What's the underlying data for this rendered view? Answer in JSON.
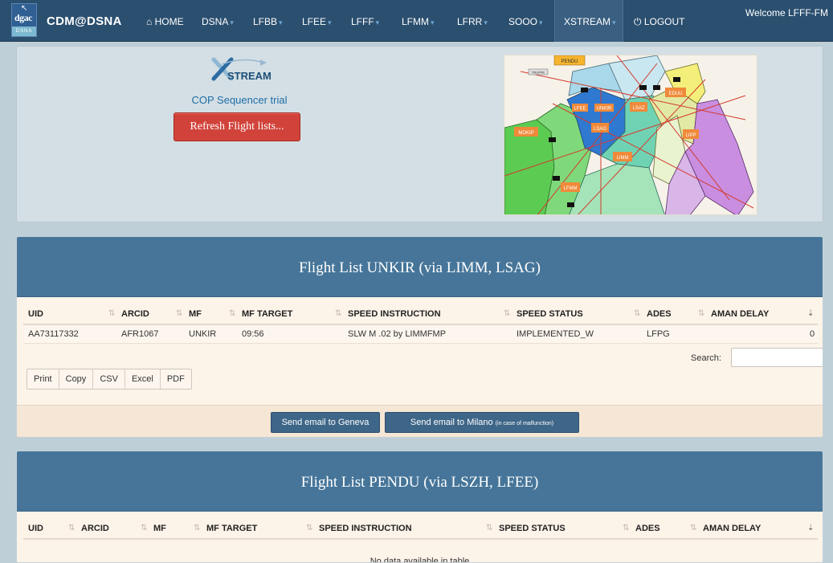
{
  "nav": {
    "logo_text": "dgac",
    "logo_sub": "DSNA",
    "logo_arrow": "↖",
    "brand": "CDM@DSNA",
    "home_icon": "home-icon",
    "items": [
      {
        "label": "HOME",
        "icon": "⌂"
      },
      {
        "label": "DSNA",
        "caret": "▾"
      },
      {
        "label": "LFBB",
        "caret": "▾"
      },
      {
        "label": "LFEE",
        "caret": "▾"
      },
      {
        "label": "LFFF",
        "caret": "▾"
      },
      {
        "label": "LFMM",
        "caret": "▾"
      },
      {
        "label": "LFRR",
        "caret": "▾"
      },
      {
        "label": "SOOO",
        "caret": "▾"
      },
      {
        "label": "XSTREAM",
        "caret": "▾"
      },
      {
        "label": "LOGOUT",
        "icon": "⏻"
      }
    ],
    "welcome": "Welcome LFFF-FM"
  },
  "xstream": {
    "logo_text": "STREAM",
    "logo_x": "X",
    "subtitle": "COP Sequencer trial",
    "refresh_label": "Refresh Flight lists...",
    "map_labels": [
      "PENDU",
      "TRUPPE",
      "LFEE",
      "EDUU",
      "UNKIR",
      "LSAZ",
      "LSAG",
      "MOKIP",
      "LIPP",
      "LIMM",
      "LFMM"
    ]
  },
  "list1": {
    "title": "Flight List UNKIR (via LIMM, LSAG)",
    "columns": [
      "UID",
      "ARCID",
      "MF",
      "MF TARGET",
      "SPEED INSTRUCTION",
      "SPEED STATUS",
      "ADES",
      "AMAN DELAY"
    ],
    "rows": [
      [
        "AA73117332",
        "AFR1067",
        "UNKIR",
        "09:56",
        "SLW M .02 by LIMMFMP",
        "IMPLEMENTED_W",
        "LFPG",
        "0"
      ]
    ],
    "search_label": "Search:",
    "export_buttons": [
      "Print",
      "Copy",
      "CSV",
      "Excel",
      "PDF"
    ],
    "mail_geneva": "Send email to Geneva",
    "mail_milano": "Send email to Milano",
    "mail_milano_note": "(in case of malfunction)"
  },
  "list2": {
    "title": "Flight List PENDU (via LSZH, LFEE)",
    "columns": [
      "UID",
      "ARCID",
      "MF",
      "MF TARGET",
      "SPEED INSTRUCTION",
      "SPEED STATUS",
      "ADES",
      "AMAN DELAY"
    ],
    "empty_text": "No data available in table"
  }
}
